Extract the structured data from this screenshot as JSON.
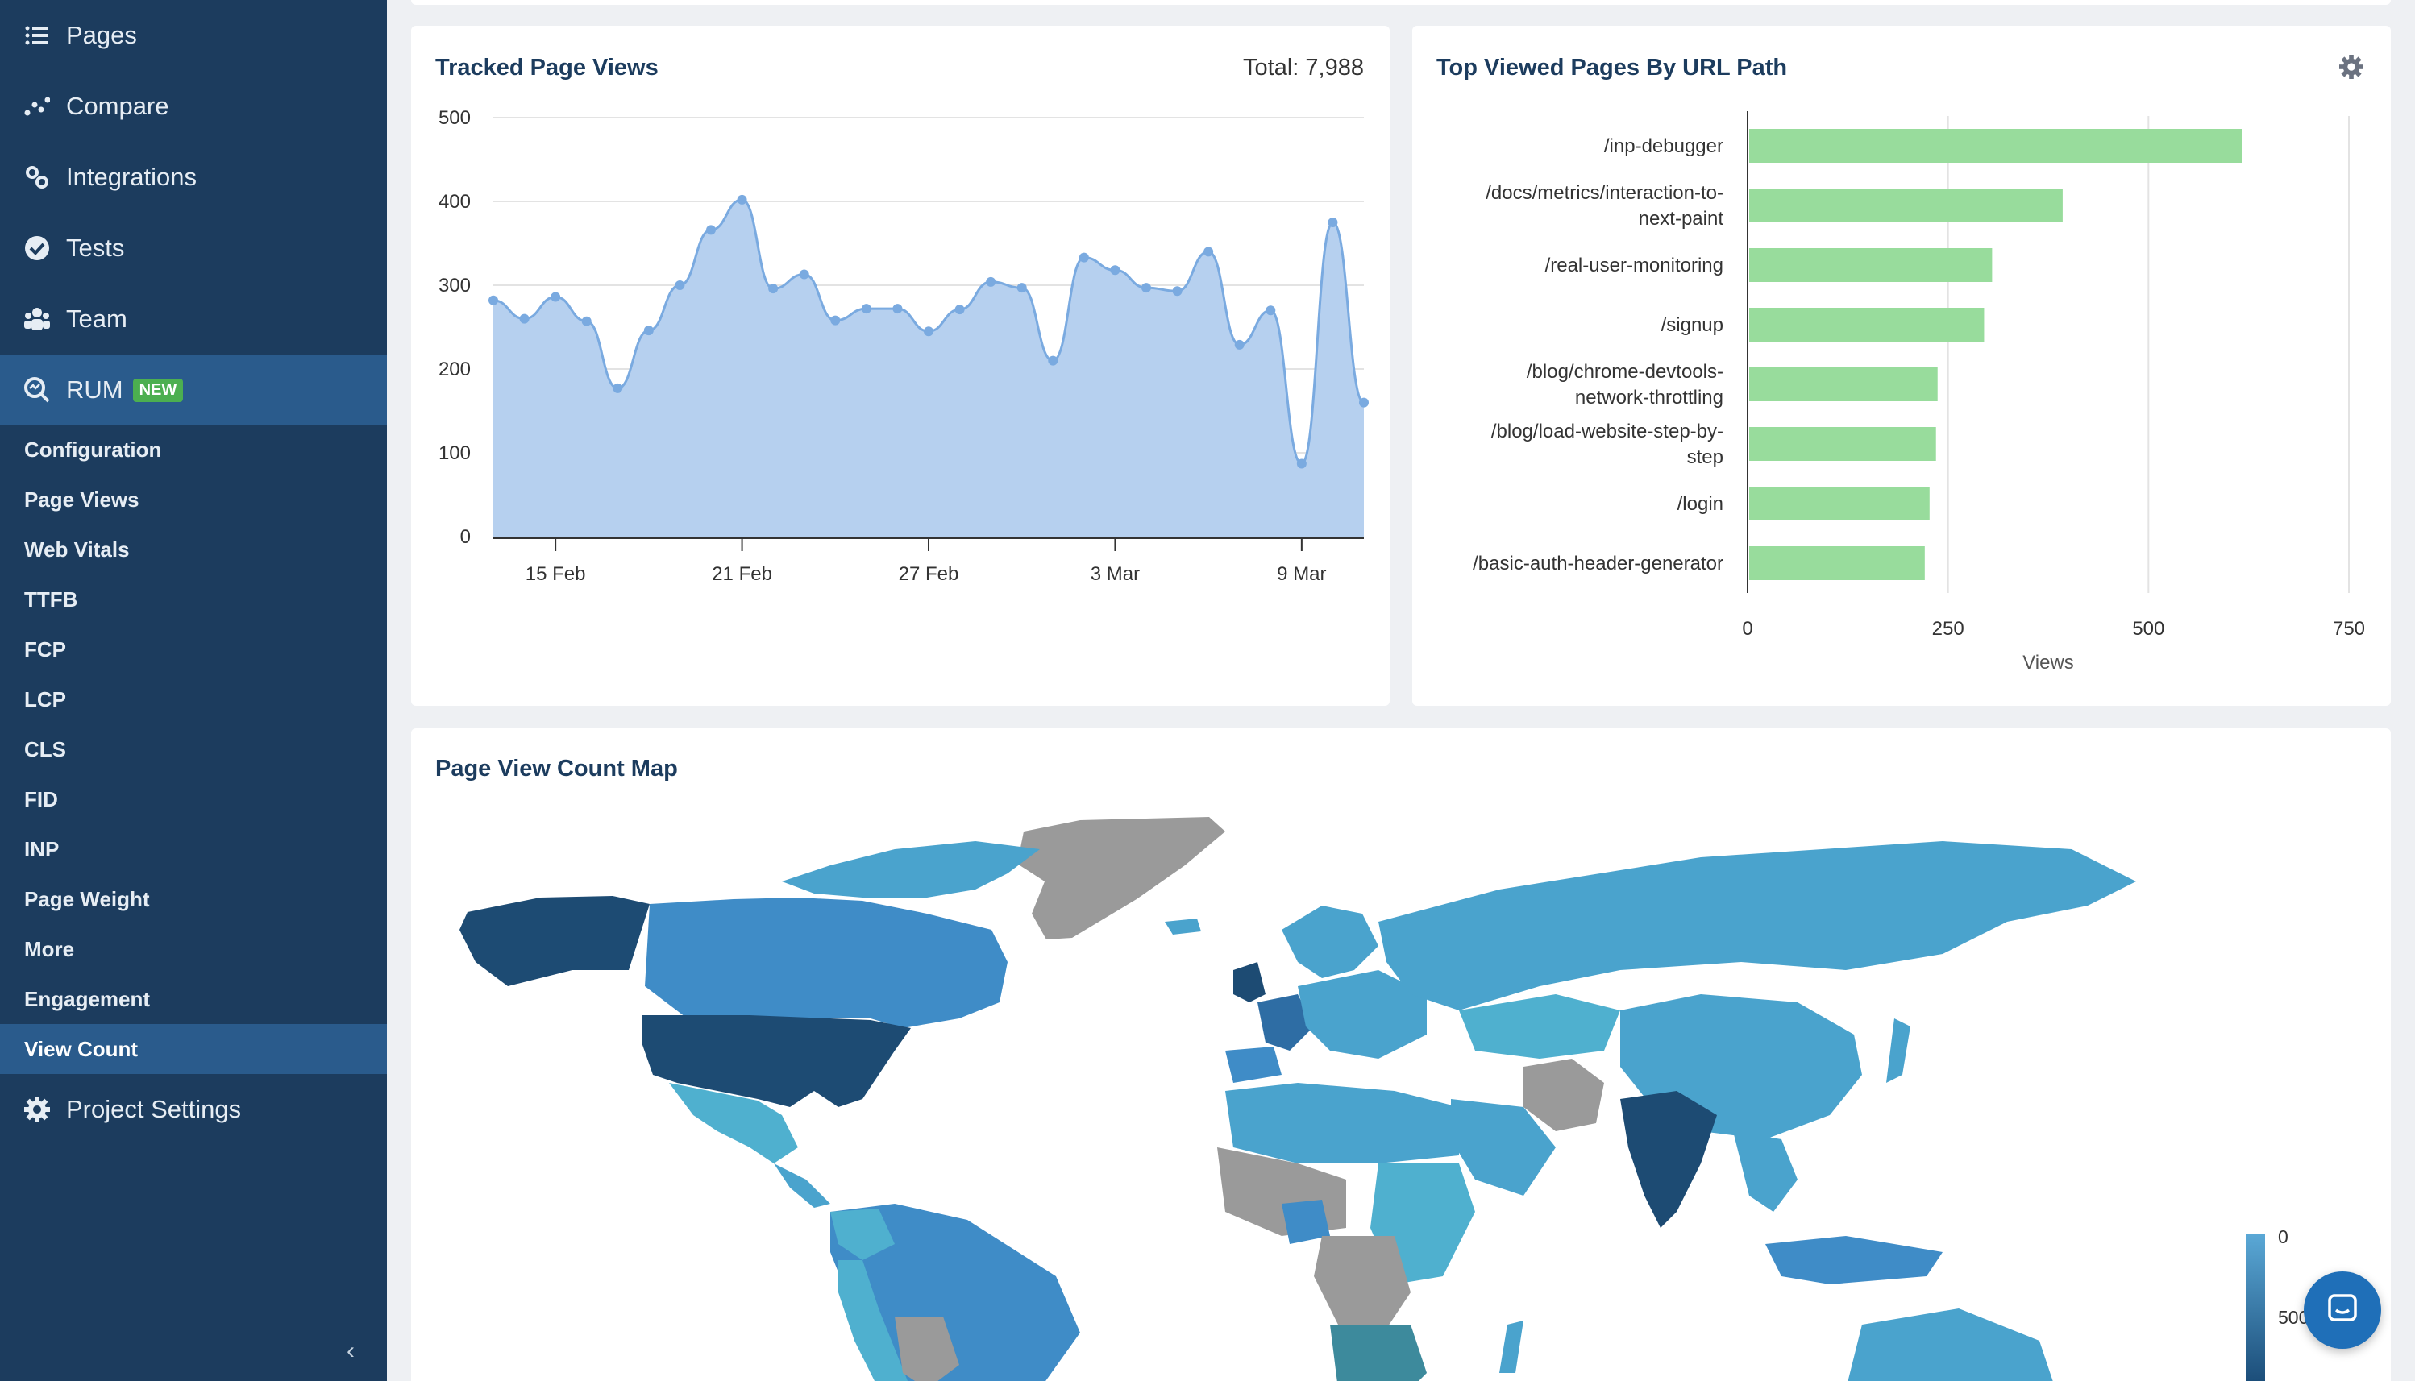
{
  "sidebar": {
    "main_items": [
      {
        "label": "Pages",
        "icon": "list-icon"
      },
      {
        "label": "Compare",
        "icon": "compare-icon"
      },
      {
        "label": "Integrations",
        "icon": "integrations-icon"
      },
      {
        "label": "Tests",
        "icon": "check-circle-icon"
      },
      {
        "label": "Team",
        "icon": "team-icon"
      },
      {
        "label": "RUM",
        "icon": "rum-search-icon",
        "badge": "NEW"
      }
    ],
    "sub_items": [
      "Configuration",
      "Page Views",
      "Web Vitals",
      "TTFB",
      "FCP",
      "LCP",
      "CLS",
      "FID",
      "INP",
      "Page Weight",
      "More",
      "Engagement",
      "View Count"
    ],
    "active_sub": "View Count",
    "settings_label": "Project Settings",
    "collapse_label": "‹"
  },
  "views_card": {
    "title": "Tracked Page Views",
    "total": "Total: 7,988"
  },
  "top_card": {
    "title": "Top Viewed Pages By URL Path"
  },
  "map_card": {
    "title": "Page View Count Map",
    "legend": [
      "0",
      "500"
    ]
  },
  "colors": {
    "sidebar": "#1c3c5e",
    "sidebar_active": "#2a5b8c",
    "area_fill": "#b6d0ef",
    "area_line": "#7aaae0",
    "bar": "#98dc9c",
    "title": "#1c3c5e"
  },
  "chart_data": [
    {
      "type": "area",
      "title": "Tracked Page Views",
      "x_tick_labels": [
        "15 Feb",
        "21 Feb",
        "27 Feb",
        "3 Mar",
        "9 Mar"
      ],
      "x": [
        "13 Feb",
        "14 Feb",
        "15 Feb",
        "16 Feb",
        "17 Feb",
        "18 Feb",
        "19 Feb",
        "20 Feb",
        "21 Feb",
        "22 Feb",
        "23 Feb",
        "24 Feb",
        "25 Feb",
        "26 Feb",
        "27 Feb",
        "28 Feb",
        "1 Mar",
        "2 Mar",
        "3 Mar",
        "4 Mar",
        "5 Mar",
        "6 Mar",
        "7 Mar",
        "8 Mar",
        "9 Mar",
        "10 Mar",
        "11 Mar",
        "12 Mar"
      ],
      "values": [
        282,
        260,
        286,
        257,
        177,
        246,
        300,
        366,
        402,
        296,
        313,
        258,
        272,
        272,
        245,
        271,
        304,
        297,
        210,
        333,
        318,
        297,
        293,
        340,
        229,
        270,
        87,
        375,
        160
      ],
      "ylim": [
        0,
        500
      ],
      "y_ticks": [
        0,
        100,
        200,
        300,
        400,
        500
      ],
      "grid": true
    },
    {
      "type": "bar",
      "title": "Top Viewed Pages By URL Path",
      "orientation": "horizontal",
      "categories": [
        "/inp-debugger",
        "/docs/metrics/interaction-to-next-paint",
        "/real-user-monitoring",
        "/signup",
        "/blog/chrome-devtools-network-throttling",
        "/blog/load-website-step-by-step",
        "/login",
        "/basic-auth-header-generator"
      ],
      "category_lines": [
        [
          "/inp-debugger"
        ],
        [
          "/docs/metrics/interaction-to-",
          "next-paint"
        ],
        [
          "/real-user-monitoring"
        ],
        [
          "/signup"
        ],
        [
          "/blog/chrome-devtools-",
          "network-throttling"
        ],
        [
          "/blog/load-website-step-by-",
          "step"
        ],
        [
          "/login"
        ],
        [
          "/basic-auth-header-generator"
        ]
      ],
      "values": [
        617,
        393,
        305,
        295,
        237,
        235,
        227,
        221
      ],
      "xlabel": "Views",
      "xlim": [
        0,
        750
      ],
      "x_ticks": [
        0,
        250,
        500,
        750
      ],
      "grid": true
    }
  ]
}
